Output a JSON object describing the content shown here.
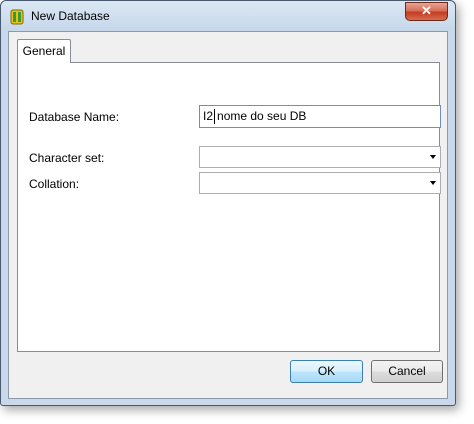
{
  "window": {
    "title": "New Database",
    "close_glyph": "✕",
    "icon": "database-app-icon"
  },
  "tabs": [
    {
      "label": "General",
      "selected": true
    }
  ],
  "form": {
    "database_name_label": "Database Name:",
    "database_name_value_before_caret": "I2",
    "database_name_value_after_caret": "nome do seu DB",
    "character_set_label": "Character set:",
    "character_set_value": "",
    "collation_label": "Collation:",
    "collation_value": ""
  },
  "buttons": {
    "ok_label": "OK",
    "cancel_label": "Cancel"
  },
  "colors": {
    "title_bar": "#c6d7ea",
    "close_button": "#c23d22",
    "ok_button_border": "#3c7fb1"
  }
}
